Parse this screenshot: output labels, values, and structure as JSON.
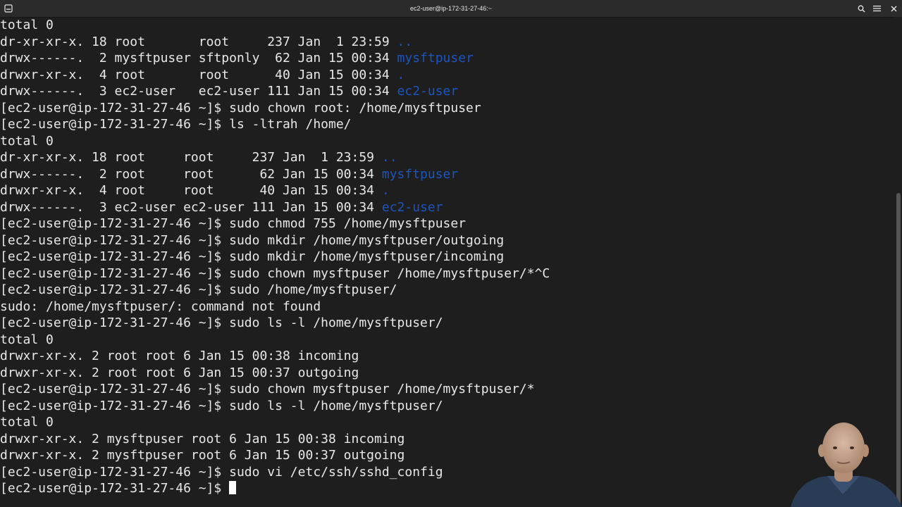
{
  "window": {
    "title": "ec2-user@ip-172-31-27-46:~",
    "icons": {
      "left": "terminal-tab-icon",
      "search": "search-icon",
      "menu": "hamburger-menu-icon",
      "close": "close-icon"
    }
  },
  "colors": {
    "background": "#1e1e1e",
    "text": "#e8e8e8",
    "directory": "#1c55c0",
    "titlebar": "#2b2b2b"
  },
  "terminal": {
    "lines": [
      {
        "text": "total 0"
      },
      {
        "text": "dr-xr-xr-x. 18 root       root     237 Jan  1 23:59 ",
        "dir": ".."
      },
      {
        "text": "drwx------.  2 mysftpuser sftponly  62 Jan 15 00:34 ",
        "dir": "mysftpuser"
      },
      {
        "text": "drwxr-xr-x.  4 root       root      40 Jan 15 00:34 ",
        "dir": "."
      },
      {
        "text": "drwx------.  3 ec2-user   ec2-user 111 Jan 15 00:34 ",
        "dir": "ec2-user"
      },
      {
        "text": "[ec2-user@ip-172-31-27-46 ~]$ sudo chown root: /home/mysftpuser"
      },
      {
        "text": "[ec2-user@ip-172-31-27-46 ~]$ ls -ltrah /home/"
      },
      {
        "text": "total 0"
      },
      {
        "text": "dr-xr-xr-x. 18 root     root     237 Jan  1 23:59 ",
        "dir": ".."
      },
      {
        "text": "drwx------.  2 root     root      62 Jan 15 00:34 ",
        "dir": "mysftpuser"
      },
      {
        "text": "drwxr-xr-x.  4 root     root      40 Jan 15 00:34 ",
        "dir": "."
      },
      {
        "text": "drwx------.  3 ec2-user ec2-user 111 Jan 15 00:34 ",
        "dir": "ec2-user"
      },
      {
        "text": "[ec2-user@ip-172-31-27-46 ~]$ sudo chmod 755 /home/mysftpuser"
      },
      {
        "text": "[ec2-user@ip-172-31-27-46 ~]$ sudo mkdir /home/mysftpuser/outgoing"
      },
      {
        "text": "[ec2-user@ip-172-31-27-46 ~]$ sudo mkdir /home/mysftpuser/incoming"
      },
      {
        "text": "[ec2-user@ip-172-31-27-46 ~]$ sudo chown mysftpuser /home/mysftpuser/*^C"
      },
      {
        "text": "[ec2-user@ip-172-31-27-46 ~]$ sudo /home/mysftpuser/"
      },
      {
        "text": "sudo: /home/mysftpuser/: command not found"
      },
      {
        "text": "[ec2-user@ip-172-31-27-46 ~]$ sudo ls -l /home/mysftpuser/"
      },
      {
        "text": "total 0"
      },
      {
        "text": "drwxr-xr-x. 2 root root 6 Jan 15 00:38 incoming"
      },
      {
        "text": "drwxr-xr-x. 2 root root 6 Jan 15 00:37 outgoing"
      },
      {
        "text": "[ec2-user@ip-172-31-27-46 ~]$ sudo chown mysftpuser /home/mysftpuser/*"
      },
      {
        "text": "[ec2-user@ip-172-31-27-46 ~]$ sudo ls -l /home/mysftpuser/"
      },
      {
        "text": "total 0"
      },
      {
        "text": "drwxr-xr-x. 2 mysftpuser root 6 Jan 15 00:38 incoming"
      },
      {
        "text": "drwxr-xr-x. 2 mysftpuser root 6 Jan 15 00:37 outgoing"
      },
      {
        "text": "[ec2-user@ip-172-31-27-46 ~]$ sudo vi /etc/ssh/sshd_config"
      }
    ],
    "prompt": "[ec2-user@ip-172-31-27-46 ~]$ "
  }
}
